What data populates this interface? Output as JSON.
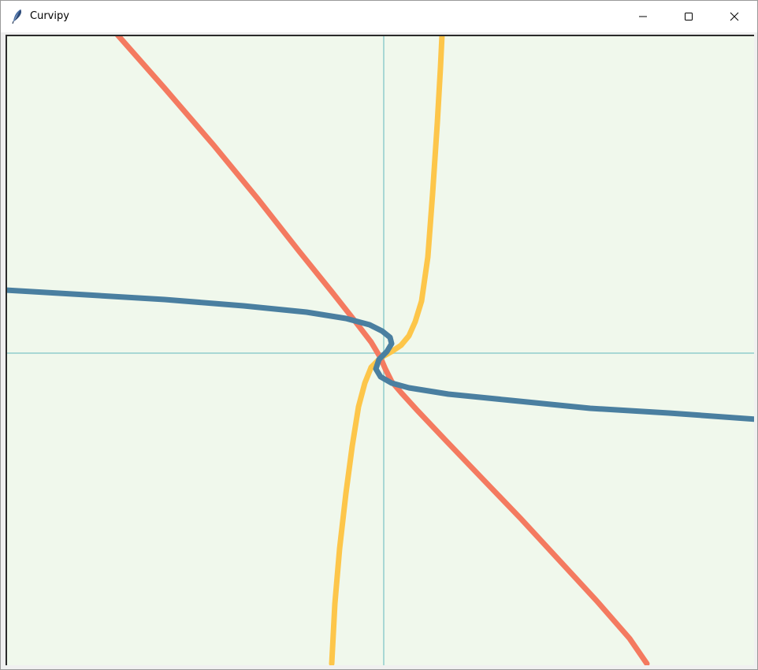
{
  "window": {
    "title": "Curvipy",
    "app_icon": "feather-icon",
    "controls": {
      "minimize_icon": "minimize-icon",
      "maximize_icon": "maximize-icon",
      "close_icon": "close-icon"
    }
  },
  "colors": {
    "canvas_background": "#f0f8ec",
    "axis": "#a8d8d4",
    "curve_red": "#f47a60",
    "curve_yellow": "#fdc64a",
    "curve_blue": "#4a7fa0"
  }
}
